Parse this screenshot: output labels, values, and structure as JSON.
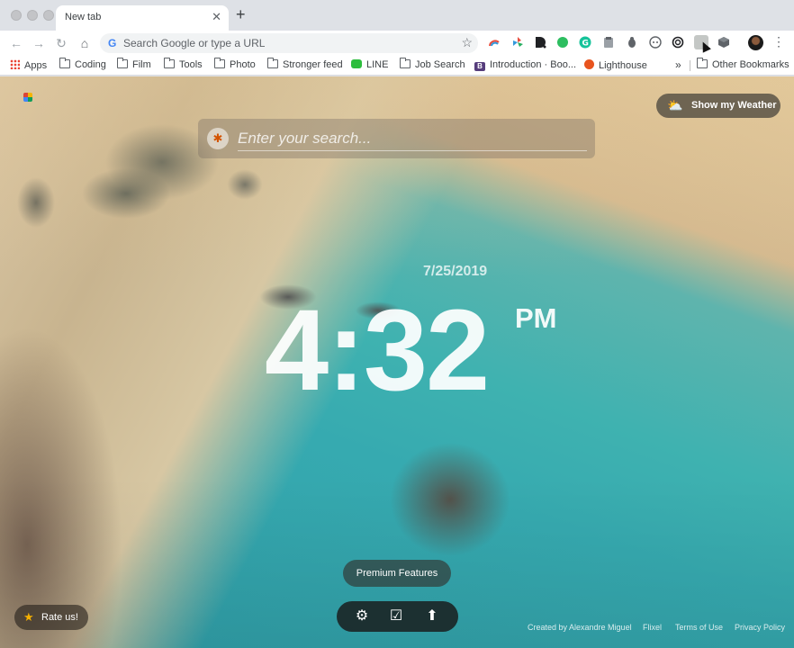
{
  "browser": {
    "tab_title": "New tab",
    "new_tab_glyph": "+",
    "close_glyph": "✕",
    "omnibox_placeholder": "Search Google or type a URL",
    "omnibox_g": "G",
    "bookmarks": [
      {
        "label": "Apps",
        "icon": "apps-grid-icon"
      },
      {
        "label": "Coding",
        "icon": "folder-icon"
      },
      {
        "label": "Film",
        "icon": "folder-icon"
      },
      {
        "label": "Tools",
        "icon": "folder-icon"
      },
      {
        "label": "Photo",
        "icon": "folder-icon"
      },
      {
        "label": "Stronger feed",
        "icon": "folder-icon"
      },
      {
        "label": "LINE",
        "icon": "line-icon"
      },
      {
        "label": "Job Search",
        "icon": "folder-icon"
      },
      {
        "label": "Introduction · Boo...",
        "icon": "bootstrap-icon"
      },
      {
        "label": "Lighthouse",
        "icon": "lighthouse-icon"
      },
      {
        "label": "Other Bookmarks",
        "icon": "folder-icon"
      }
    ],
    "bookmarks_overflow": "»",
    "bootstrap_letter": "B",
    "extensions": [
      {
        "name": "rainbow-arc-icon",
        "color": "#e84c3d"
      },
      {
        "name": "pinwheel-icon",
        "color": "#27ae60"
      },
      {
        "name": "d-logo-icon",
        "color": "#202124"
      },
      {
        "name": "evernote-icon",
        "color": "#2dbe60"
      },
      {
        "name": "grammarly-icon",
        "color": "#15c39a"
      },
      {
        "name": "clipboard-icon",
        "color": "#9aa0a6"
      },
      {
        "name": "bug-icon",
        "color": "#5f6368"
      },
      {
        "name": "circle-dots-icon",
        "color": "#5f6368"
      },
      {
        "name": "openai-knot-icon",
        "color": "#202124"
      },
      {
        "name": "gray-square-icon",
        "color": "#9aa0a6"
      },
      {
        "name": "cube-icon",
        "color": "#5f6368"
      }
    ]
  },
  "page": {
    "weather_label": "Show my Weather",
    "weather_icon": "⛅",
    "search_placeholder": "Enter your search...",
    "search_logo": "✱",
    "date": "7/25/2019",
    "time": "4:32",
    "ampm": "PM",
    "premium_label": "Premium Features",
    "toolbar_icons": {
      "gear": "⚙",
      "check": "☑",
      "upload": "⬆"
    },
    "rate_label": "Rate us!",
    "rate_star": "★",
    "footer": {
      "credit": "Created by Alexandre Miguel",
      "flixel": "Flixel",
      "terms": "Terms of Use",
      "privacy": "Privacy Policy"
    }
  }
}
